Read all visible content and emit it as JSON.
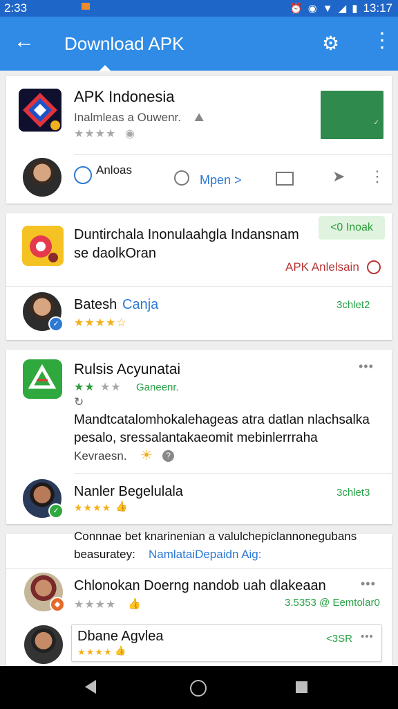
{
  "status": {
    "time": "2:33",
    "clock": "13:17"
  },
  "appbar": {
    "title": "Download APK"
  },
  "top_app": {
    "name": "APK Indonesia",
    "subtitle": "Inalmleas a Ouwenr.",
    "stars": "★★★★",
    "author_label": "Anloas",
    "action_label": "Mpen >"
  },
  "promo": {
    "line1": "Duntirchala Inonulaahgla Indansnam",
    "line2": "se daolkOran",
    "badge": "<0 Inoak",
    "link": "APK Anlelsain"
  },
  "review1": {
    "name": "Batesh",
    "tag": "Canja",
    "stars": "★★★★☆",
    "status": "3chlet2"
  },
  "app2": {
    "name": "Rulsis Acyunatai",
    "stars_filled": "★★",
    "stars_empty": "★★",
    "publisher": "Ganeenr.",
    "desc1": "Mandtcatalomhokalehageas atra datlan nlachsalka",
    "desc2": "pesalo, sressalantakaeomit mebinlerrraha",
    "footer": "Kevraesn."
  },
  "review2": {
    "name": "Nanler Begelulala",
    "stars": "★★★★",
    "status": "3chlet3"
  },
  "comment": {
    "line1": "Connnae bet knarinenian a valulchepiclannonegubans",
    "prefix": "beasuratey:",
    "link": "NamlataiDepaidn Aig:"
  },
  "review3": {
    "name": "Chlonokan Doerng nandob uah dlakeaan",
    "stars": "★★★★",
    "status": "3.5353 @ Eemtolar0"
  },
  "review4": {
    "name": "Dbane Agvlea",
    "stars": "★★★★",
    "status": "<3SR"
  },
  "colors": {
    "primary": "#2f8be6",
    "status_bar": "#1f66c9",
    "green": "#27a046",
    "red": "#b83535"
  }
}
